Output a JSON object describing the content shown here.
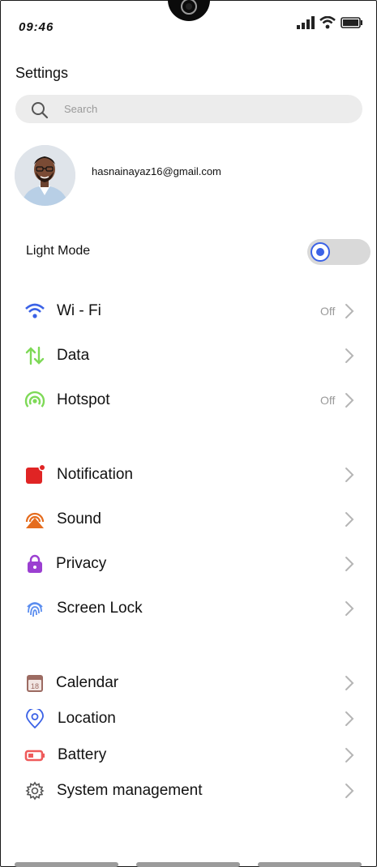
{
  "status": {
    "time": "09:46"
  },
  "page": {
    "title": "Settings"
  },
  "search": {
    "placeholder": "Search"
  },
  "profile": {
    "email": "hasnainayaz16@gmail.com"
  },
  "mode": {
    "label": "Light Mode",
    "enabled": true
  },
  "rows": [
    {
      "label": "Wi - Fi",
      "value": "Off",
      "icon": "wifi-icon",
      "color": "#3b62e6"
    },
    {
      "label": "Data",
      "value": "",
      "icon": "data-arrows-icon",
      "color": "#7ed957"
    },
    {
      "label": "Hotspot",
      "value": "Off",
      "icon": "hotspot-icon",
      "color": "#7ed957"
    },
    {
      "label": "Notification",
      "value": "",
      "icon": "notification-icon",
      "color": "#e02424"
    },
    {
      "label": "Sound",
      "value": "",
      "icon": "sound-icon",
      "color": "#e56c1e"
    },
    {
      "label": "Privacy",
      "value": "",
      "icon": "lock-icon",
      "color": "#9b3fd1"
    },
    {
      "label": "Screen Lock",
      "value": "",
      "icon": "fingerprint-icon",
      "color": "#5b8def"
    },
    {
      "label": "Calendar",
      "value": "",
      "icon": "calendar-icon",
      "color": "#9c6b62",
      "badge": "18"
    },
    {
      "label": "Location",
      "value": "",
      "icon": "location-pin-icon",
      "color": "#3b62e6"
    },
    {
      "label": "Battery",
      "value": "",
      "icon": "battery-icon",
      "color": "#ef5b5b"
    },
    {
      "label": "System management",
      "value": "",
      "icon": "gear-icon",
      "color": "#555555"
    }
  ]
}
